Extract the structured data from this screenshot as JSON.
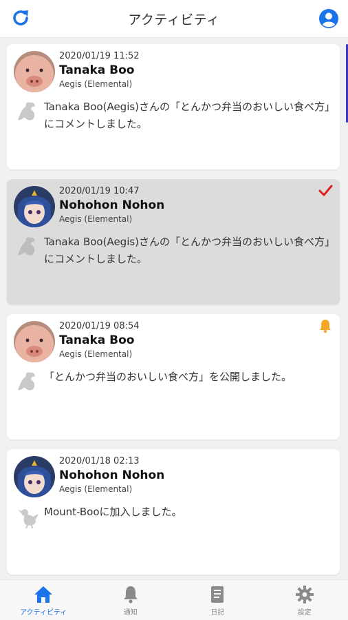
{
  "header": {
    "title": "アクティビティ",
    "refresh_icon": "refresh-icon",
    "account_icon": "account-circle-icon"
  },
  "colors": {
    "accent": "#1a73e8",
    "read_bg": "#dcdcdc",
    "check": "#e02020",
    "bell": "#f5a623"
  },
  "feed": {
    "items": [
      {
        "timestamp": "2020/01/19 11:52",
        "name": "Tanaka Boo",
        "server": "Aegis (Elemental)",
        "message": "Tanaka Boo(Aegis)さんの「とんかつ弁当のおいしい食べ方」にコメントしました。",
        "avatar": "pig-avatar",
        "kind_icon": "dragon-icon",
        "badge": null,
        "read": false
      },
      {
        "timestamp": "2020/01/19 10:47",
        "name": "Nohohon Nohon",
        "server": "Aegis (Elemental)",
        "message": "Tanaka Boo(Aegis)さんの「とんかつ弁当のおいしい食べ方」にコメントしました。",
        "avatar": "character-avatar",
        "kind_icon": "dragon-icon",
        "badge": "check-icon",
        "read": true
      },
      {
        "timestamp": "2020/01/19 08:54",
        "name": "Tanaka Boo",
        "server": "Aegis (Elemental)",
        "message": "「とんかつ弁当のおいしい食べ方」を公開しました。",
        "avatar": "pig-avatar",
        "kind_icon": "dragon-icon",
        "badge": "bell-icon",
        "read": false
      },
      {
        "timestamp": "2020/01/18 02:13",
        "name": "Nohohon Nohon",
        "server": "Aegis (Elemental)",
        "message": "Mount-Booに加入しました。",
        "avatar": "character-avatar",
        "kind_icon": "chocobo-icon",
        "badge": null,
        "read": false
      }
    ]
  },
  "nav": {
    "items": [
      {
        "label": "アクティビティ",
        "icon": "home-icon",
        "active": true
      },
      {
        "label": "通知",
        "icon": "bell-icon",
        "active": false
      },
      {
        "label": "日記",
        "icon": "book-icon",
        "active": false
      },
      {
        "label": "設定",
        "icon": "gear-icon",
        "active": false
      }
    ]
  }
}
